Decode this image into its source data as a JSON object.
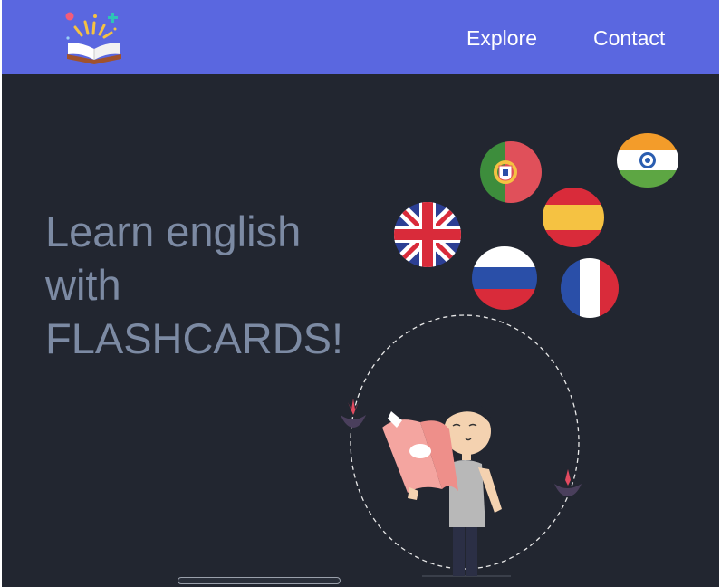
{
  "nav": {
    "logo_icon": "open-book-with-sparkles-icon",
    "links": [
      {
        "label": "Explore"
      },
      {
        "label": "Contact"
      }
    ]
  },
  "hero": {
    "title_lines": [
      "Learn english",
      "with",
      "FLASHCARDS!"
    ]
  },
  "illustration": {
    "flags": [
      "portugal-flag-icon",
      "india-flag-icon",
      "uk-flag-icon",
      "spain-flag-icon",
      "russia-flag-icon",
      "france-flag-icon"
    ],
    "figure": "person-reading-book-illustration"
  },
  "colors": {
    "navbar": "#5a67e0",
    "background": "#222630",
    "title_text": "#7c8aa3"
  }
}
